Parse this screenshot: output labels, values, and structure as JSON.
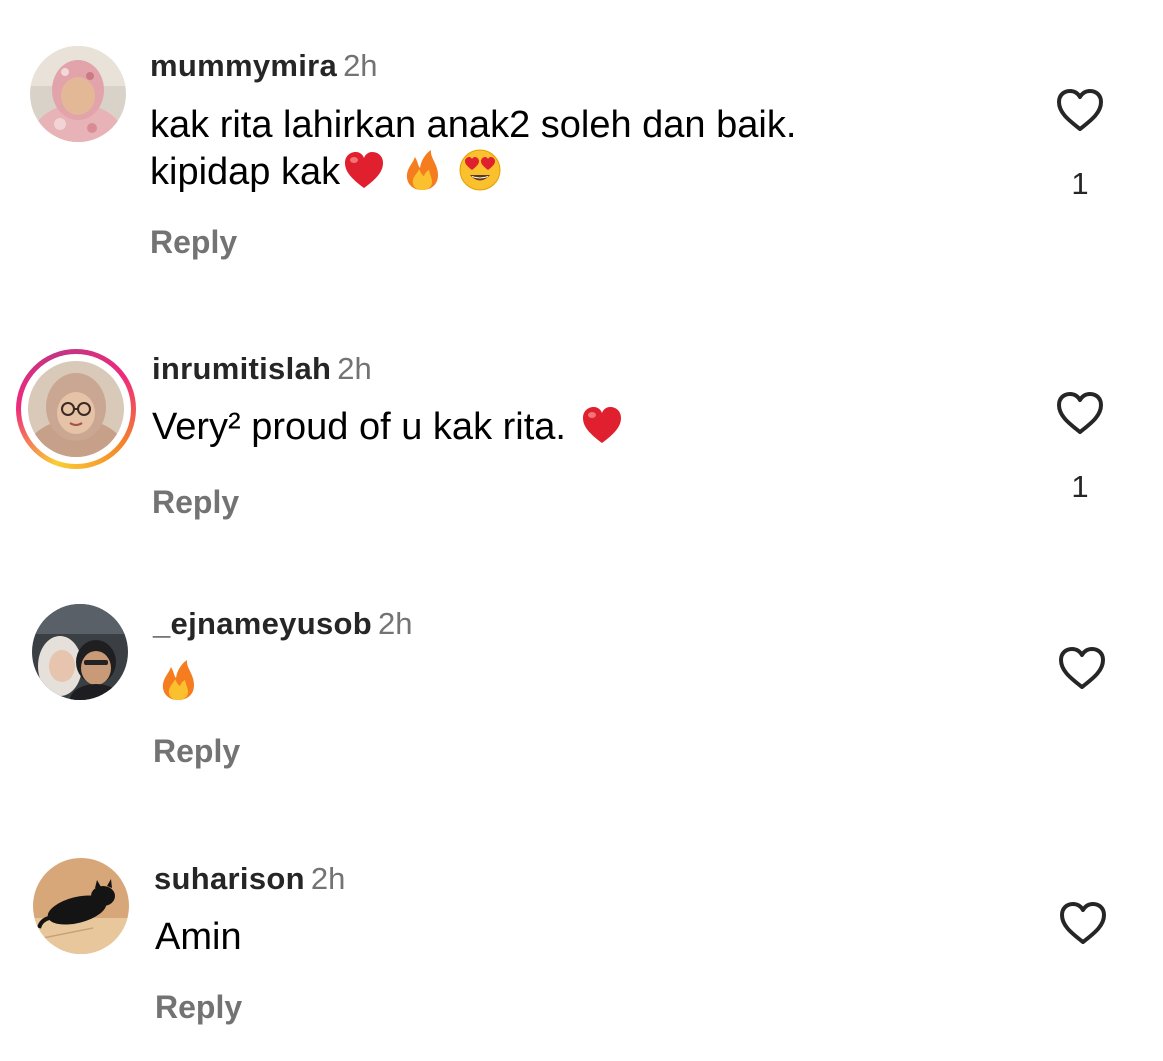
{
  "comments": [
    {
      "username": "mummymira",
      "time": "2h",
      "text_line1": "kak rita lahirkan anak2 soleh dan baik.",
      "text_line2": "kipidap kak",
      "reply_label": "Reply",
      "like_count": "1",
      "emojis": [
        "heart-emoji",
        "fire-emoji",
        "heart-eyes-emoji"
      ]
    },
    {
      "username": "inrumitislah",
      "time": "2h",
      "text": "Very² proud of u kak rita.",
      "reply_label": "Reply",
      "like_count": "1",
      "emojis": [
        "heart-emoji"
      ],
      "has_story_ring": true
    },
    {
      "username": "_ejnameyusob",
      "time": "2h",
      "text": "",
      "reply_label": "Reply",
      "like_count": "",
      "emojis": [
        "fire-emoji"
      ]
    },
    {
      "username": "suharison",
      "time": "2h",
      "text": "Amin",
      "reply_label": "Reply",
      "like_count": ""
    }
  ],
  "colors": {
    "username": "#262626",
    "secondary": "#737373",
    "heart_emoji": "#e0202e",
    "story_ring": [
      "#f9ce34",
      "#ee2a7b",
      "#c13584"
    ]
  },
  "icons": {
    "like": "heart-outline-icon"
  }
}
